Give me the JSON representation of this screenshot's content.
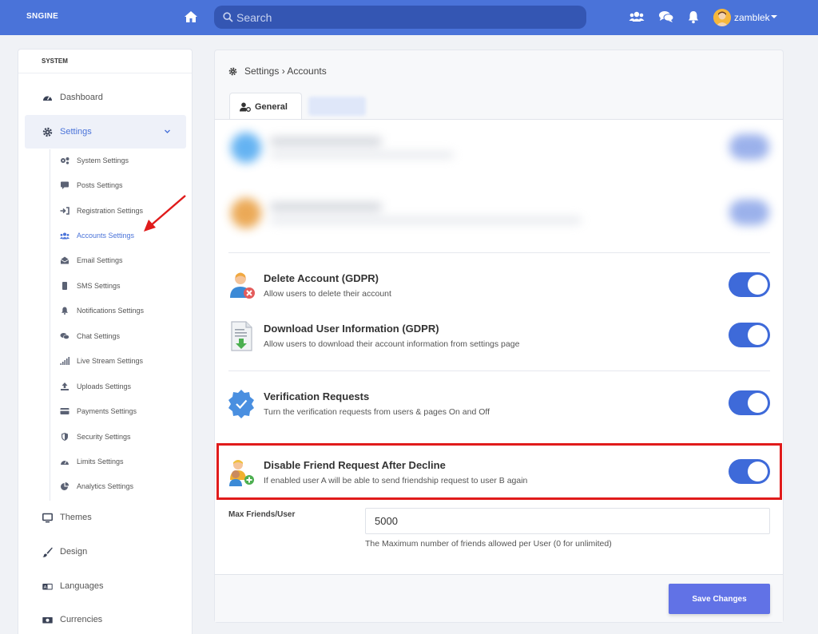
{
  "colors": {
    "topbar": "#4a73d9",
    "accent": "#4a73d9",
    "toggle_on": "#3e6ad9",
    "save_button": "#6172e6",
    "highlight": "#e01b1b"
  },
  "topbar": {
    "brand": "SNGINE",
    "search_placeholder": "Search",
    "username": "zamblek",
    "icons": [
      "home-icon",
      "search-icon",
      "friends-icon",
      "messages-icon",
      "notifications-icon",
      "avatar",
      "caret-down-icon"
    ]
  },
  "sidebar": {
    "section": "SYSTEM",
    "items": [
      {
        "label": "Dashboard",
        "icon": "dashboard-icon"
      },
      {
        "label": "Settings",
        "icon": "gear-icon",
        "active": true,
        "expanded": true
      },
      {
        "label": "Themes",
        "icon": "monitor-icon"
      },
      {
        "label": "Design",
        "icon": "brush-icon"
      },
      {
        "label": "Languages",
        "icon": "language-icon"
      },
      {
        "label": "Currencies",
        "icon": "money-icon"
      }
    ],
    "sub_items": [
      {
        "label": "System Settings",
        "icon": "cogs-icon"
      },
      {
        "label": "Posts Settings",
        "icon": "comment-icon"
      },
      {
        "label": "Registration Settings",
        "icon": "sign-in-icon"
      },
      {
        "label": "Accounts Settings",
        "icon": "users-icon",
        "active": true
      },
      {
        "label": "Email Settings",
        "icon": "envelope-icon"
      },
      {
        "label": "SMS Settings",
        "icon": "mobile-icon"
      },
      {
        "label": "Notifications Settings",
        "icon": "bell-icon"
      },
      {
        "label": "Chat Settings",
        "icon": "comments-icon"
      },
      {
        "label": "Live Stream Settings",
        "icon": "signal-icon"
      },
      {
        "label": "Uploads Settings",
        "icon": "upload-icon"
      },
      {
        "label": "Payments Settings",
        "icon": "credit-card-icon"
      },
      {
        "label": "Security Settings",
        "icon": "shield-icon"
      },
      {
        "label": "Limits Settings",
        "icon": "gauge-icon"
      },
      {
        "label": "Analytics Settings",
        "icon": "pie-chart-icon"
      }
    ]
  },
  "main": {
    "breadcrumb": "Settings › Accounts",
    "tab_general": "General",
    "settings": [
      {
        "title": "Delete Account (GDPR)",
        "desc": "Allow users to delete their account",
        "enabled": true,
        "icon": "delete-account-icon"
      },
      {
        "title": "Download User Information (GDPR)",
        "desc": "Allow users to download their account information from settings page",
        "enabled": true,
        "icon": "download-document-icon"
      },
      {
        "title": "Verification Requests",
        "desc": "Turn the verification requests from users & pages On and Off",
        "enabled": true,
        "icon": "verified-badge-icon"
      },
      {
        "title": "Disable Friend Request After Decline",
        "desc": "If enabled user A will be able to send friendship request to user B again",
        "enabled": true,
        "icon": "add-friends-icon"
      }
    ],
    "max_friends": {
      "label": "Max Friends/User",
      "value": "5000",
      "help": "The Maximum number of friends allowed per User (0 for unlimited)"
    },
    "save_label": "Save Changes"
  }
}
